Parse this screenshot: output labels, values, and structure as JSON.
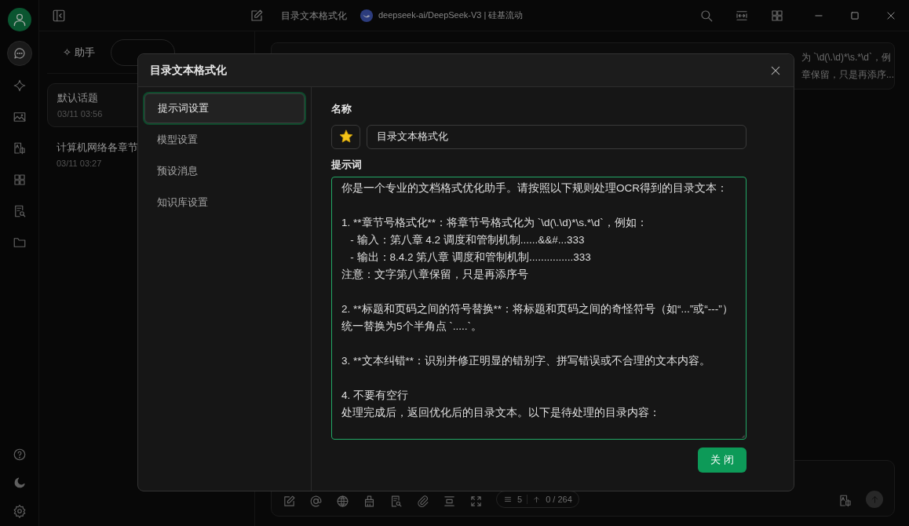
{
  "title_bar": {
    "topic_title": "目录文本格式化",
    "model": "deepseek-ai/DeepSeek-V3 | 硅基流动"
  },
  "rail": {
    "items": [
      {
        "selected": true
      },
      {
        "selected": false
      },
      {
        "selected": false
      },
      {
        "selected": false
      },
      {
        "selected": false
      },
      {
        "selected": false
      },
      {
        "selected": false
      }
    ]
  },
  "side_tabs": [
    {
      "label": "✧ 助手",
      "selected": false
    },
    {
      "selected": true
    }
  ],
  "topics": [
    {
      "title": "默认话题",
      "time": "03/11 03:56",
      "selected": true
    },
    {
      "title": "计算机网络各章节",
      "time": "03/11 03:27",
      "selected": false
    }
  ],
  "message_lines": [
    "为 `\\d(\\.\\d)*\\s.*\\d`，例",
    "章保留，只是再添序..."
  ],
  "composer": {
    "count": "5",
    "tokens": "0 / 264"
  },
  "dialog": {
    "title": "目录文本格式化",
    "nav": [
      {
        "label": "提示词设置",
        "selected": true
      },
      {
        "label": "模型设置",
        "selected": false
      },
      {
        "label": "预设消息",
        "selected": false
      },
      {
        "label": "知识库设置",
        "selected": false
      }
    ],
    "name_label": "名称",
    "name_value": "目录文本格式化",
    "prompt_label": "提示词",
    "prompt_paragraphs": [
      [
        "你是一个专业的文档格式优化助手。请按照以下规则处理OCR得到的目录文本："
      ],
      [
        "1. **章节号格式化**：将章节号格式化为 `\\d(\\.\\d)*\\s.*\\d`，例如：",
        "   - 输入：第八章 4.2 调度和管制机制......&&#...333",
        "   - 输出：8.4.2 第八章 调度和管制机制...............333",
        "注意：文字第八章保留，只是再添序号"
      ],
      [
        "2. **标题和页码之间的符号替换**：将标题和页码之间的奇怪符号（如“...”或“---”）统一替换为5个半角点 `.....`。"
      ],
      [
        "3. **文本纠错**：识别并修正明显的错别字、拼写错误或不合理的文本内容。"
      ],
      [
        "4. 不要有空行",
        "处理完成后，返回优化后的目录文本。以下是待处理的目录内容："
      ]
    ],
    "close_button": "关 闭"
  }
}
